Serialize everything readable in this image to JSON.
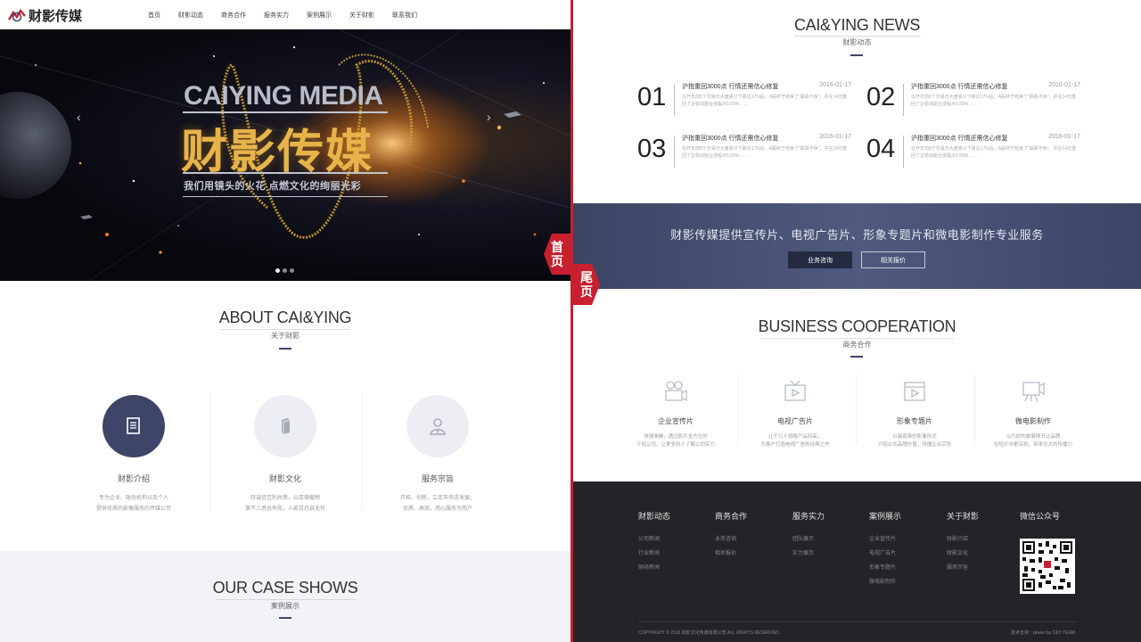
{
  "nav": {
    "logo": "财影传媒",
    "items": [
      "首页",
      "财影动态",
      "商务合作",
      "服务实力",
      "案例展示",
      "关于财影",
      "联系我们"
    ]
  },
  "hero": {
    "title_en": "CAIYING MEDIA",
    "title_cn": "财影传媒",
    "tagline": "我们用镜头的火花 点燃文化的绚丽光彩",
    "slide_count": 3,
    "active_slide": 1
  },
  "about": {
    "title": "ABOUT CAI&YING",
    "subtitle": "关于财影",
    "items": [
      {
        "title": "财影介绍",
        "desc1": "专为企业、政府机构以及个人",
        "desc2": "提供优质的影像服务的传媒公司"
      },
      {
        "title": "财影文化",
        "desc1": "持诚信互利共荣，以厚德载物",
        "desc2": "事不三思总有败，人能百忍自无忧"
      },
      {
        "title": "服务宗旨",
        "desc1": "开拓、创新，立足市场求发展；",
        "desc2": "优质、高效，用心服务为用户"
      }
    ]
  },
  "case": {
    "title": "OUR CASE SHOWS",
    "subtitle": "案例展示"
  },
  "tags": {
    "left": [
      "首",
      "页"
    ],
    "right": [
      "尾",
      "页"
    ]
  },
  "news": {
    "title": "CAI&YING NEWS",
    "subtitle": "财影动态",
    "items": [
      {
        "num": "01",
        "title": "沪指重回3000点 行情还需信心修复",
        "date": "2016-01-17",
        "desc": "在开年前8个交易日大盘累计下跌近17%后，A股终于结束了“跌跌不休”，并在14日重回了企稳动能业涨幅大5.59%……"
      },
      {
        "num": "02",
        "title": "沪指重回3000点 行情还需信心修复",
        "date": "2016-01-17",
        "desc": "在开年前8个交易日大盘累计下跌近17%后，A股终于结束了“跌跌不休”，并在14日重回了企稳动能业涨幅大5.59%……"
      },
      {
        "num": "03",
        "title": "沪指重回3000点 行情还需信心修复",
        "date": "2016-01-17",
        "desc": "在开年前8个交易日大盘累计下跌近17%后，A股终于结束了“跌跌不休”，并在14日重回了企稳动能业涨幅大5.59%……"
      },
      {
        "num": "04",
        "title": "沪指重回3000点 行情还需信心修复",
        "date": "2016-01-17",
        "desc": "在开年前8个交易日大盘累计下跌近17%后，A股终于结束了“跌跌不休”，并在14日重回了企稳动能业涨幅大5.59%……"
      }
    ]
  },
  "banner": {
    "text": "财影传媒提供宣传片、电视广告片、形象专题片和微电影制作专业服务",
    "btn_consult": "业务咨询",
    "btn_quote": "相关报价"
  },
  "business": {
    "title": "BUSINESS COOPERATION",
    "subtitle": "商务合作",
    "items": [
      {
        "title": "企业宣传片",
        "desc1": "快速准确，透过影片全方位的",
        "desc2": "介绍公司，让更多的人了解公司实力"
      },
      {
        "title": "电视广告片",
        "desc1": "让千万人领略产品风采，",
        "desc2": "为客户打造电视广告的经典之作"
      },
      {
        "title": "形象专题片",
        "desc1": "以最真挚的影像形式",
        "desc2": "介绍公司品牌价值，传播企业宗旨"
      },
      {
        "title": "微电影制作",
        "desc1": "以巧妙的故事情节让品牌",
        "desc2": "在短片中更深刻，带来巨大的传播力"
      }
    ]
  },
  "footer": {
    "cols": [
      {
        "head": "财影动态",
        "items": [
          "公司新闻",
          "行业新闻",
          "财经新闻"
        ]
      },
      {
        "head": "商务合作",
        "items": [
          "业务咨询",
          "相关报价"
        ]
      },
      {
        "head": "服务实力",
        "items": [
          "团队展示",
          "实力展示"
        ]
      },
      {
        "head": "案例展示",
        "items": [
          "企业宣传片",
          "电视广告片",
          "形象专题片",
          "微电影制作"
        ]
      },
      {
        "head": "关于财影",
        "items": [
          "财影介绍",
          "财影文化",
          "服务宗旨"
        ]
      }
    ],
    "wechat": "微信公众号",
    "copyright": "COPYRIGHT © 2016 财影文化传媒有限公司 ALL RIGHTS RESERVED.",
    "powered": "技术支持：power by C&Y TEAM"
  },
  "colors": {
    "accent": "#3e4568",
    "tag": "#c8202f",
    "footer": "#242428",
    "hero_gold": "#e8b44a"
  }
}
